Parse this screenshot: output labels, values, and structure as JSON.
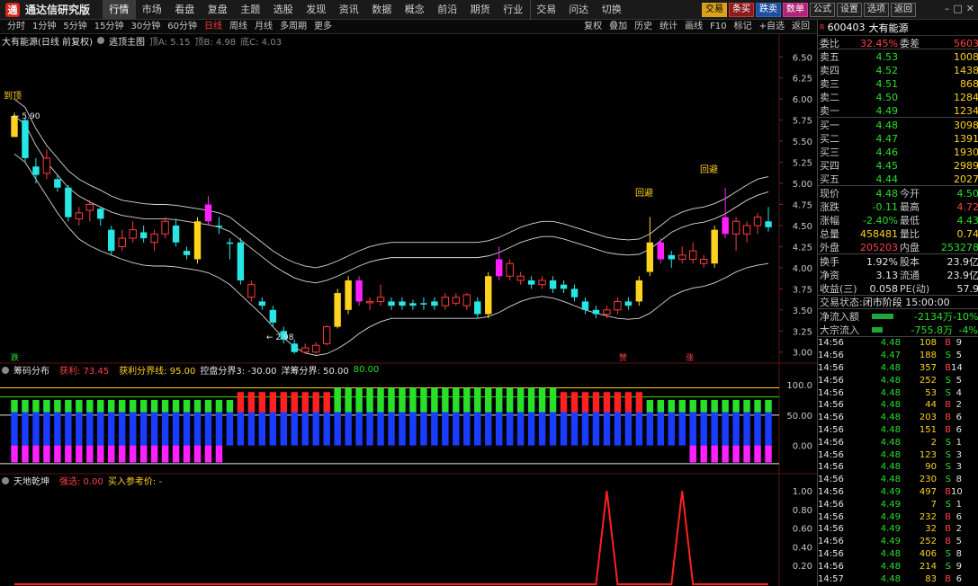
{
  "app": {
    "logo_glyph": "通",
    "title": "通达信研究版"
  },
  "menu": [
    "行情",
    "市场",
    "看盘",
    "复盘",
    "主题",
    "选股",
    "发现",
    "资讯",
    "数据",
    "概念",
    "前沿",
    "期货",
    "行业",
    "交易",
    "问达",
    "切换"
  ],
  "top_buttons": [
    {
      "label": "交易",
      "style": "or"
    },
    {
      "label": "条买",
      "style": "rd"
    },
    {
      "label": "跌卖",
      "style": "bl"
    },
    {
      "label": "数单",
      "style": "pk"
    },
    {
      "label": "公式",
      "style": ""
    },
    {
      "label": "设置",
      "style": ""
    },
    {
      "label": "选项",
      "style": ""
    },
    {
      "label": "返回",
      "style": ""
    }
  ],
  "window_controls": [
    "–",
    "□",
    "✕"
  ],
  "periods": [
    "分时",
    "1分钟",
    "5分钟",
    "15分钟",
    "30分钟",
    "60分钟",
    "日线",
    "周线",
    "月线",
    "多周期",
    "更多"
  ],
  "active_period": "日线",
  "right_tools": [
    "复权",
    "叠加",
    "历史",
    "统计",
    "画线",
    "F10",
    "标记",
    "+自选",
    "返回"
  ],
  "main_header": {
    "name": "大有能源(日线 前复权)",
    "indicator": "逃顶主图",
    "p1": "顶A: 5.15",
    "p2": "顶B: 4.98",
    "p3": "底C: 4.03"
  },
  "price_axis": [
    "6.50",
    "6.25",
    "6.00",
    "5.75",
    "5.50",
    "5.25",
    "5.00",
    "4.75",
    "4.50",
    "4.25",
    "4.00",
    "3.75",
    "3.50",
    "3.25",
    "3.00"
  ],
  "annotations": {
    "top_label": "到顶",
    "high": "5.90",
    "low": "2.98",
    "escape1": "回避",
    "escape2": "回避",
    "bottom_left": "跌",
    "bottom_mid": "赞",
    "bottom_right": "涨"
  },
  "chip": {
    "title": "筹码分布",
    "profit": "获利: 73.45",
    "line1": "获利分界线: 95.00",
    "line2": "控盘分界3: -30.00",
    "line3": "洋筹分界: 50.00",
    "line4": "80.00",
    "axis": [
      "100.0",
      "50.00",
      "0.00"
    ]
  },
  "tdqk": {
    "title": "天地乾坤",
    "p1": "强选: 0.00",
    "p2": "买入参考价: -",
    "axis": [
      "1.00",
      "0.80",
      "0.60",
      "0.40",
      "0.20"
    ]
  },
  "quote": {
    "r": "R",
    "code": "600403",
    "name": "大有能源",
    "weibi_label": "委比",
    "weibi": "32.45%",
    "weicha_label": "委差",
    "weicha": "5603",
    "sells": [
      {
        "label": "卖五",
        "price": "4.53",
        "vol": "1008"
      },
      {
        "label": "卖四",
        "price": "4.52",
        "vol": "1438"
      },
      {
        "label": "卖三",
        "price": "4.51",
        "vol": "868"
      },
      {
        "label": "卖二",
        "price": "4.50",
        "vol": "1284"
      },
      {
        "label": "卖一",
        "price": "4.49",
        "vol": "1234"
      }
    ],
    "buys": [
      {
        "label": "买一",
        "price": "4.48",
        "vol": "3098"
      },
      {
        "label": "买二",
        "price": "4.47",
        "vol": "1391"
      },
      {
        "label": "买三",
        "price": "4.46",
        "vol": "1930"
      },
      {
        "label": "买四",
        "price": "4.45",
        "vol": "2989"
      },
      {
        "label": "买五",
        "price": "4.44",
        "vol": "2027"
      }
    ],
    "stats": [
      {
        "l1": "现价",
        "v1": "4.48",
        "c1": "grn",
        "l2": "今开",
        "v2": "4.50",
        "c2": "grn"
      },
      {
        "l1": "涨跌",
        "v1": "-0.11",
        "c1": "grn",
        "l2": "最高",
        "v2": "4.72",
        "c2": "red"
      },
      {
        "l1": "涨幅",
        "v1": "-2.40%",
        "c1": "grn",
        "l2": "最低",
        "v2": "4.43",
        "c2": "grn"
      },
      {
        "l1": "总量",
        "v1": "458481",
        "c1": "yel",
        "l2": "量比",
        "v2": "0.74",
        "c2": "yel"
      },
      {
        "l1": "外盘",
        "v1": "205203",
        "c1": "red",
        "l2": "内盘",
        "v2": "253278",
        "c2": "grn"
      }
    ],
    "stats2": [
      {
        "l1": "换手",
        "v1": "1.92%",
        "l2": "股本",
        "v2": "23.9亿"
      },
      {
        "l1": "净资",
        "v1": "3.13",
        "l2": "流通",
        "v2": "23.9亿"
      },
      {
        "l1": "收益(三)",
        "v1": "0.058",
        "l2": "PE(动)",
        "v2": "57.9"
      }
    ],
    "trade_status_label": "交易状态:",
    "trade_status": "闭市阶段 15:00:00",
    "flows": [
      {
        "label": "净流入额",
        "val": "-2134万",
        "pct": "-10%",
        "bar": 0.6
      },
      {
        "label": "大宗流入",
        "val": "-755.8万",
        "pct": "-4%",
        "bar": 0.3
      }
    ],
    "ticks": [
      [
        "14:56",
        "4.48",
        "108",
        "B",
        "9"
      ],
      [
        "14:56",
        "4.47",
        "188",
        "S",
        "5"
      ],
      [
        "14:56",
        "4.48",
        "357",
        "B",
        "14"
      ],
      [
        "14:56",
        "4.48",
        "252",
        "S",
        "5"
      ],
      [
        "14:56",
        "4.48",
        "53",
        "S",
        "4"
      ],
      [
        "14:56",
        "4.48",
        "44",
        "B",
        "2"
      ],
      [
        "14:56",
        "4.48",
        "203",
        "B",
        "6"
      ],
      [
        "14:56",
        "4.48",
        "151",
        "B",
        "6"
      ],
      [
        "14:56",
        "4.48",
        "2",
        "S",
        "1"
      ],
      [
        "14:56",
        "4.48",
        "123",
        "S",
        "3"
      ],
      [
        "14:56",
        "4.48",
        "90",
        "S",
        "3"
      ],
      [
        "14:56",
        "4.48",
        "230",
        "S",
        "8"
      ],
      [
        "14:56",
        "4.49",
        "497",
        "B",
        "10"
      ],
      [
        "14:56",
        "4.49",
        "7",
        "S",
        "1"
      ],
      [
        "14:56",
        "4.49",
        "232",
        "B",
        "6"
      ],
      [
        "14:56",
        "4.49",
        "32",
        "B",
        "2"
      ],
      [
        "14:56",
        "4.49",
        "252",
        "B",
        "5"
      ],
      [
        "14:56",
        "4.48",
        "406",
        "S",
        "8"
      ],
      [
        "14:56",
        "4.48",
        "214",
        "S",
        "9"
      ],
      [
        "14:57",
        "4.48",
        "83",
        "B",
        "6"
      ]
    ]
  },
  "colors": {
    "up": "#ff3b3b",
    "down": "#27e6e6",
    "yellow": "#ffd21e",
    "magenta": "#ff20ff",
    "green": "#28e028",
    "blue": "#1a3cff",
    "red": "#ff2020"
  },
  "chart_data": {
    "type": "candlestick",
    "candles": [
      [
        5.55,
        5.8,
        5.84,
        5.56,
        "Y"
      ],
      [
        5.75,
        5.3,
        5.78,
        5.25,
        "C"
      ],
      [
        5.2,
        5.1,
        5.3,
        5.0,
        "C"
      ],
      [
        5.12,
        5.3,
        5.4,
        5.05,
        "R"
      ],
      [
        5.05,
        4.95,
        5.1,
        4.9,
        "C"
      ],
      [
        4.95,
        4.6,
        4.98,
        4.55,
        "C"
      ],
      [
        4.58,
        4.65,
        4.72,
        4.5,
        "R"
      ],
      [
        4.68,
        4.75,
        4.8,
        4.55,
        "R"
      ],
      [
        4.7,
        4.58,
        4.72,
        4.5,
        "C"
      ],
      [
        4.45,
        4.2,
        4.5,
        4.15,
        "C"
      ],
      [
        4.25,
        4.35,
        4.45,
        4.2,
        "R"
      ],
      [
        4.35,
        4.45,
        4.55,
        4.3,
        "R"
      ],
      [
        4.42,
        4.35,
        4.5,
        4.3,
        "C"
      ],
      [
        4.3,
        4.4,
        4.45,
        4.2,
        "R"
      ],
      [
        4.4,
        4.55,
        4.6,
        4.35,
        "R"
      ],
      [
        4.5,
        4.3,
        4.58,
        4.25,
        "C"
      ],
      [
        4.2,
        4.15,
        4.25,
        4.1,
        "C"
      ],
      [
        4.1,
        4.55,
        4.6,
        4.05,
        "Y"
      ],
      [
        4.55,
        4.75,
        4.85,
        4.5,
        "M"
      ],
      [
        4.5,
        4.5,
        4.6,
        4.4,
        "C"
      ],
      [
        4.3,
        4.3,
        4.35,
        4.1,
        "C"
      ],
      [
        4.3,
        3.85,
        4.35,
        3.8,
        "C"
      ],
      [
        3.8,
        3.65,
        3.85,
        3.6,
        "R"
      ],
      [
        3.6,
        3.55,
        3.65,
        3.5,
        "C"
      ],
      [
        3.5,
        3.35,
        3.55,
        3.3,
        "C"
      ],
      [
        3.25,
        3.15,
        3.3,
        3.1,
        "C"
      ],
      [
        3.1,
        3.0,
        3.15,
        2.98,
        "C"
      ],
      [
        3.0,
        3.05,
        3.1,
        2.98,
        "R"
      ],
      [
        3.0,
        3.08,
        3.12,
        2.98,
        "R"
      ],
      [
        3.1,
        3.3,
        3.32,
        3.08,
        "R"
      ],
      [
        3.3,
        3.7,
        3.75,
        3.28,
        "Y"
      ],
      [
        3.5,
        3.85,
        3.9,
        3.45,
        "Y"
      ],
      [
        3.85,
        3.6,
        3.9,
        3.55,
        "M"
      ],
      [
        3.6,
        3.6,
        3.65,
        3.5,
        "R"
      ],
      [
        3.6,
        3.65,
        3.8,
        3.55,
        "R"
      ],
      [
        3.6,
        3.55,
        3.65,
        3.5,
        "C"
      ],
      [
        3.55,
        3.6,
        3.65,
        3.5,
        "C"
      ],
      [
        3.55,
        3.58,
        3.62,
        3.5,
        "C"
      ],
      [
        3.58,
        3.58,
        3.65,
        3.5,
        "C"
      ],
      [
        3.6,
        3.55,
        3.65,
        3.5,
        "C"
      ],
      [
        3.55,
        3.65,
        3.7,
        3.5,
        "R"
      ],
      [
        3.65,
        3.58,
        3.7,
        3.55,
        "R"
      ],
      [
        3.55,
        3.68,
        3.7,
        3.5,
        "R"
      ],
      [
        3.6,
        3.45,
        3.65,
        3.4,
        "C"
      ],
      [
        3.45,
        3.9,
        3.95,
        3.4,
        "Y"
      ],
      [
        3.9,
        4.1,
        4.25,
        3.85,
        "M"
      ],
      [
        4.05,
        3.9,
        4.1,
        3.85,
        "R"
      ],
      [
        3.9,
        3.85,
        3.95,
        3.8,
        "R"
      ],
      [
        3.85,
        3.8,
        3.9,
        3.75,
        "C"
      ],
      [
        3.8,
        3.85,
        3.9,
        3.75,
        "R"
      ],
      [
        3.85,
        3.75,
        3.9,
        3.7,
        "C"
      ],
      [
        3.75,
        3.8,
        3.85,
        3.7,
        "C"
      ],
      [
        3.75,
        3.65,
        3.8,
        3.6,
        "C"
      ],
      [
        3.6,
        3.5,
        3.65,
        3.45,
        "C"
      ],
      [
        3.5,
        3.45,
        3.55,
        3.4,
        "C"
      ],
      [
        3.45,
        3.5,
        3.55,
        3.4,
        "R"
      ],
      [
        3.5,
        3.6,
        3.65,
        3.45,
        "R"
      ],
      [
        3.6,
        3.55,
        3.65,
        3.5,
        "C"
      ],
      [
        3.6,
        3.85,
        3.9,
        3.55,
        "Y"
      ],
      [
        3.95,
        4.3,
        4.6,
        3.9,
        "Y"
      ],
      [
        4.3,
        4.1,
        4.35,
        4.05,
        "M"
      ],
      [
        4.1,
        4.15,
        4.2,
        4.0,
        "C"
      ],
      [
        4.15,
        4.1,
        4.25,
        4.05,
        "R"
      ],
      [
        4.1,
        4.2,
        4.3,
        4.05,
        "R"
      ],
      [
        4.1,
        4.05,
        4.15,
        4.0,
        "R"
      ],
      [
        4.05,
        4.45,
        4.5,
        4.0,
        "Y"
      ],
      [
        4.4,
        4.6,
        4.95,
        4.35,
        "M"
      ],
      [
        4.55,
        4.4,
        4.6,
        4.2,
        "R"
      ],
      [
        4.4,
        4.5,
        4.55,
        4.3,
        "R"
      ],
      [
        4.5,
        4.6,
        4.65,
        4.4,
        "R"
      ],
      [
        4.55,
        4.48,
        4.72,
        4.43,
        "C"
      ]
    ],
    "upper_band": [
      6.0,
      5.9,
      5.65,
      5.45,
      5.3,
      5.15,
      5.05,
      4.98,
      4.92,
      4.85,
      4.8,
      4.78,
      4.76,
      4.75,
      4.75,
      4.74,
      4.72,
      4.7,
      4.68,
      4.65,
      4.6,
      4.5,
      4.4,
      4.3,
      4.2,
      4.12,
      4.06,
      4.02,
      4.0,
      4.03,
      4.08,
      4.14,
      4.2,
      4.25,
      4.28,
      4.3,
      4.3,
      4.3,
      4.3,
      4.3,
      4.3,
      4.3,
      4.3,
      4.3,
      4.32,
      4.36,
      4.42,
      4.48,
      4.52,
      4.55,
      4.55,
      4.52,
      4.48,
      4.44,
      4.4,
      4.36,
      4.34,
      4.33,
      4.34,
      4.4,
      4.5,
      4.6,
      4.66,
      4.7,
      4.72,
      4.76,
      4.82,
      4.9,
      4.98,
      5.05,
      5.08
    ],
    "upper_band2": [
      5.8,
      5.7,
      5.45,
      5.25,
      5.1,
      4.95,
      4.85,
      4.78,
      4.72,
      4.66,
      4.62,
      4.6,
      4.58,
      4.58,
      4.58,
      4.57,
      4.55,
      4.53,
      4.51,
      4.48,
      4.43,
      4.33,
      4.23,
      4.13,
      4.03,
      3.95,
      3.88,
      3.84,
      3.82,
      3.85,
      3.9,
      3.96,
      4.02,
      4.07,
      4.1,
      4.12,
      4.12,
      4.12,
      4.12,
      4.12,
      4.12,
      4.12,
      4.12,
      4.12,
      4.14,
      4.18,
      4.24,
      4.3,
      4.34,
      4.37,
      4.37,
      4.34,
      4.3,
      4.26,
      4.22,
      4.18,
      4.16,
      4.15,
      4.16,
      4.22,
      4.32,
      4.42,
      4.48,
      4.52,
      4.54,
      4.58,
      4.64,
      4.72,
      4.8,
      4.86,
      4.9
    ],
    "lower_band": [
      5.35,
      5.25,
      5.05,
      4.85,
      4.65,
      4.48,
      4.34,
      4.26,
      4.2,
      4.15,
      4.1,
      4.06,
      4.03,
      4.02,
      4.02,
      4.01,
      3.99,
      3.97,
      3.94,
      3.88,
      3.8,
      3.68,
      3.56,
      3.44,
      3.3,
      3.17,
      3.06,
      2.99,
      2.96,
      2.98,
      3.04,
      3.12,
      3.22,
      3.3,
      3.36,
      3.4,
      3.4,
      3.4,
      3.4,
      3.4,
      3.4,
      3.4,
      3.4,
      3.4,
      3.42,
      3.47,
      3.54,
      3.6,
      3.64,
      3.66,
      3.64,
      3.6,
      3.55,
      3.5,
      3.46,
      3.43,
      3.4,
      3.39,
      3.4,
      3.46,
      3.56,
      3.66,
      3.72,
      3.76,
      3.78,
      3.82,
      3.88,
      3.95,
      4.0,
      4.03,
      4.05
    ],
    "chip_green": [
      0,
      0,
      0,
      0,
      0,
      0,
      0,
      20,
      20,
      20,
      20,
      0,
      0,
      0,
      0,
      0,
      0,
      0,
      0,
      0,
      0,
      0,
      0,
      0,
      0,
      0,
      0,
      0,
      0,
      0,
      0,
      0,
      0,
      0,
      0,
      0,
      0,
      0,
      0,
      0,
      0,
      0,
      0,
      0,
      0,
      0,
      0,
      0,
      0,
      0,
      0,
      0,
      0,
      0,
      0,
      0,
      0,
      0,
      0,
      0,
      0,
      0,
      0,
      0,
      0,
      0,
      0,
      0,
      0,
      0,
      0
    ],
    "tdqk_signal_x": [
      55,
      62
    ]
  }
}
